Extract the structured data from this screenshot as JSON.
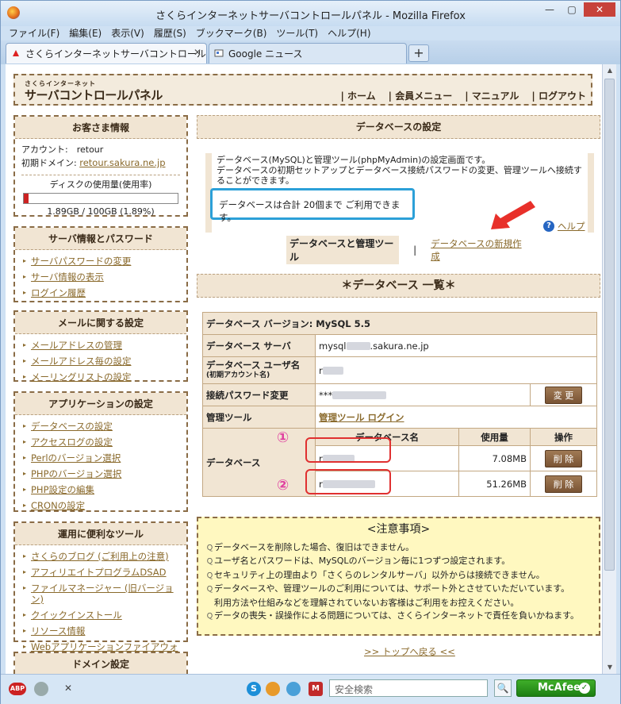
{
  "window": {
    "title": "さくらインターネットサーバコントロールパネル - Mozilla Firefox"
  },
  "menu": [
    "ファイル(F)",
    "編集(E)",
    "表示(V)",
    "履歴(S)",
    "ブックマーク(B)",
    "ツール(T)",
    "ヘルプ(H)"
  ],
  "tabs": [
    {
      "label": "さくらインターネットサーバコントロールパネル"
    },
    {
      "label": "Google ニュース"
    }
  ],
  "header": {
    "logo_small": "さくらインターネット",
    "logo_main": "サーバコントロールパネル",
    "nav": [
      "ホーム",
      "会員メニュー",
      "マニュアル",
      "ログアウト"
    ]
  },
  "customer": {
    "title": "お客さま情報",
    "account_label": "アカウント:",
    "account_value": "retour",
    "domain_label": "初期ドメイン:",
    "domain_value": "retour.sakura.ne.jp",
    "disk_title": "ディスクの使用量(使用率)",
    "disk_usage": "1.89GB / 100GB (1.89%)",
    "disk_fraction": 0.0189
  },
  "server_menu": {
    "title": "サーバ情報とパスワード",
    "items": [
      "サーバパスワードの変更",
      "サーバ情報の表示",
      "ログイン履歴"
    ]
  },
  "mail_menu": {
    "title": "メールに関する設定",
    "items": [
      "メールアドレスの管理",
      "メールアドレス毎の設定",
      "メーリングリストの設定"
    ]
  },
  "app_menu": {
    "title": "アプリケーションの設定",
    "items": [
      "データベースの設定",
      "アクセスログの設定",
      "Perlのバージョン選択",
      "PHPのバージョン選択",
      "PHP設定の編集",
      "CRONの設定"
    ]
  },
  "tools_menu": {
    "title": "運用に便利なツール",
    "items": [
      "さくらのブログ (ご利用上の注意)",
      "アフィリエイトプログラムDSAD",
      "ファイルマネージャー (旧バージョン)",
      "クイックインストール",
      "リソース情報",
      "Webアプリケーションファイアウォール"
    ]
  },
  "domain_menu": {
    "title": "ドメイン設定"
  },
  "main": {
    "heading": "データベースの設定",
    "intro_line1": "データベース(MySQL)と管理ツール(phpMyAdmin)の設定画面です。",
    "intro_line2": "データベースの初期セットアップとデータベース接続パスワードの変更、管理ツールへ接続することができます。",
    "limit_text": "データベースは合計 20個まで ご利用できます。",
    "help": "ヘルプ",
    "tab_current": "データベースと管理ツール",
    "tab_new": "データベースの新規作成",
    "list_heading": "＊データベース 一覧＊"
  },
  "db_table": {
    "version_label": "データベース バージョン: MySQL 5.5",
    "server_label": "データベース サーバ",
    "server_prefix": "mysql",
    "server_suffix": ".sakura.ne.jp",
    "user_label": "データベース ユーザ名",
    "user_sub": "(初期アカウント名)",
    "user_prefix": "r",
    "pw_label": "接続パスワード変更",
    "pw_prefix": "***",
    "change_button": "変 更",
    "tool_label": "管理ツール",
    "tool_link": "管理ツール ログイン",
    "db_label": "データベース",
    "col_name": "データベース名",
    "col_usage": "使用量",
    "col_action": "操作",
    "rows": [
      {
        "name_prefix": "r",
        "usage": "7.08MB",
        "action": "削 除",
        "marker": "①"
      },
      {
        "name_prefix": "r",
        "usage": "51.26MB",
        "action": "削 除",
        "marker": "②"
      }
    ]
  },
  "notice": {
    "title": "<注意事項>",
    "items": [
      "データベースを削除した場合、復旧はできません。",
      "ユーザ名とパスワードは、MySQLのバージョン毎に1つずつ設定されます。",
      "セキュリティ上の理由より「さくらのレンタルサーバ」以外からは接続できません。",
      "データベースや、管理ツールのご利用については、サポート外とさせていただいています。",
      "利用方法や仕組みなどを理解されていないお客様はご利用をお控えください。",
      "データの喪失・誤操作による問題については、さくらインターネットで責任を負いかねます。"
    ]
  },
  "back_to_top": ">> トップへ戻る <<",
  "statusbar": {
    "search_placeholder": "安全検索",
    "mcafee": "McAfee"
  }
}
